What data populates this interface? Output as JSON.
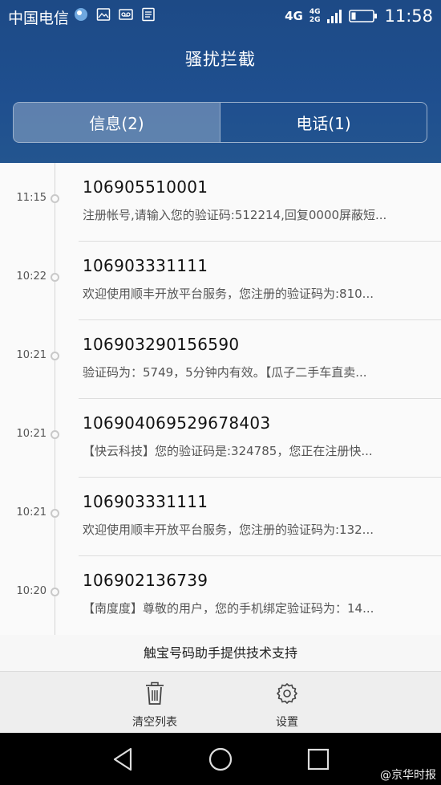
{
  "status_bar": {
    "carrier": "中国电信",
    "network_primary": "4G",
    "network_secondary_top": "4G",
    "network_secondary_bottom": "2G",
    "time": "11:58"
  },
  "header": {
    "title": "骚扰拦截",
    "tabs": [
      {
        "label": "信息(2)",
        "active": true
      },
      {
        "label": "电话(1)",
        "active": false
      }
    ]
  },
  "messages": [
    {
      "time": "11:15",
      "sender": "106905510001",
      "preview": "注册帐号,请输入您的验证码:512214,回复0000屏蔽短..."
    },
    {
      "time": "10:22",
      "sender": "106903331111",
      "preview": "欢迎使用顺丰开放平台服务，您注册的验证码为:810..."
    },
    {
      "time": "10:21",
      "sender": "106903290156590",
      "preview": "验证码为：5749，5分钟内有效。【瓜子二手车直卖..."
    },
    {
      "time": "10:21",
      "sender": "106904069529678403",
      "preview": "【快云科技】您的验证码是:324785，您正在注册快..."
    },
    {
      "time": "10:21",
      "sender": "106903331111",
      "preview": "欢迎使用顺丰开放平台服务，您注册的验证码为:132..."
    },
    {
      "time": "10:20",
      "sender": "106902136739",
      "preview": "【南度度】尊敬的用户，您的手机绑定验证码为：14..."
    }
  ],
  "footer_note": "触宝号码助手提供技术支持",
  "toolbar": {
    "clear_label": "清空列表",
    "clear_icon": "trash-icon",
    "settings_label": "设置",
    "settings_icon": "gear-icon"
  },
  "watermark": "@京华时报",
  "colors": {
    "header_bg": "#1f4f8f",
    "tab_active_bg": "#5a80b0",
    "list_bg": "#fafafa",
    "toolbar_bg": "#eeeeee",
    "navbar_bg": "#000000"
  }
}
